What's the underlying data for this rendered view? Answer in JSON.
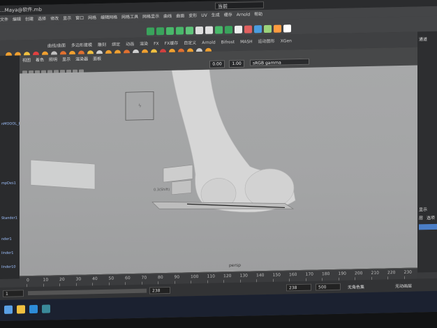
{
  "titlebar": {
    "title": "...Maya@软件.mb",
    "search_text": "当前"
  },
  "menus": [
    "文件",
    "编辑",
    "创建",
    "选择",
    "修改",
    "显示",
    "窗口",
    "网格",
    "编辑网格",
    "网格工具",
    "网格显示",
    "曲线",
    "曲面",
    "变形",
    "UV",
    "生成",
    "缓存",
    "Arnold",
    "帮助"
  ],
  "shelf_tabs": [
    "曲线/曲面",
    "多边形建模",
    "雕刻",
    "绑定",
    "动画",
    "渲染",
    "FX",
    "FX缓存",
    "自定义",
    "Arnold",
    "Bifrost",
    "MASH",
    "运动图形",
    "XGen"
  ],
  "panel_menu": [
    "视图",
    "着色",
    "照明",
    "显示",
    "渲染器",
    "面板"
  ],
  "panel": {
    "exposure": "0.00",
    "gamma_value": "1.00",
    "colorspace": "sRGB gamma"
  },
  "viewport": {
    "camera": "persp"
  },
  "right_panel": {
    "top_label": "通道",
    "display_tab": "显示",
    "layer_label": "层",
    "option_label": "选项"
  },
  "timeline_ticks": [
    "0",
    "10",
    "20",
    "30",
    "40",
    "50",
    "60",
    "70",
    "80",
    "90",
    "100",
    "110",
    "120",
    "130",
    "140",
    "150",
    "160",
    "170",
    "180",
    "190",
    "200",
    "210",
    "220",
    "230"
  ],
  "range": {
    "start": "1",
    "start_field": "1",
    "end_field": "238",
    "anim_end": "238",
    "max_end": "500",
    "char_set": "无角色集",
    "anim_layer": "无动画层"
  },
  "colors": {
    "accent": "#4b7ec6",
    "viewport": "#a5a6a7",
    "ui_dark": "#3a3b3d"
  }
}
